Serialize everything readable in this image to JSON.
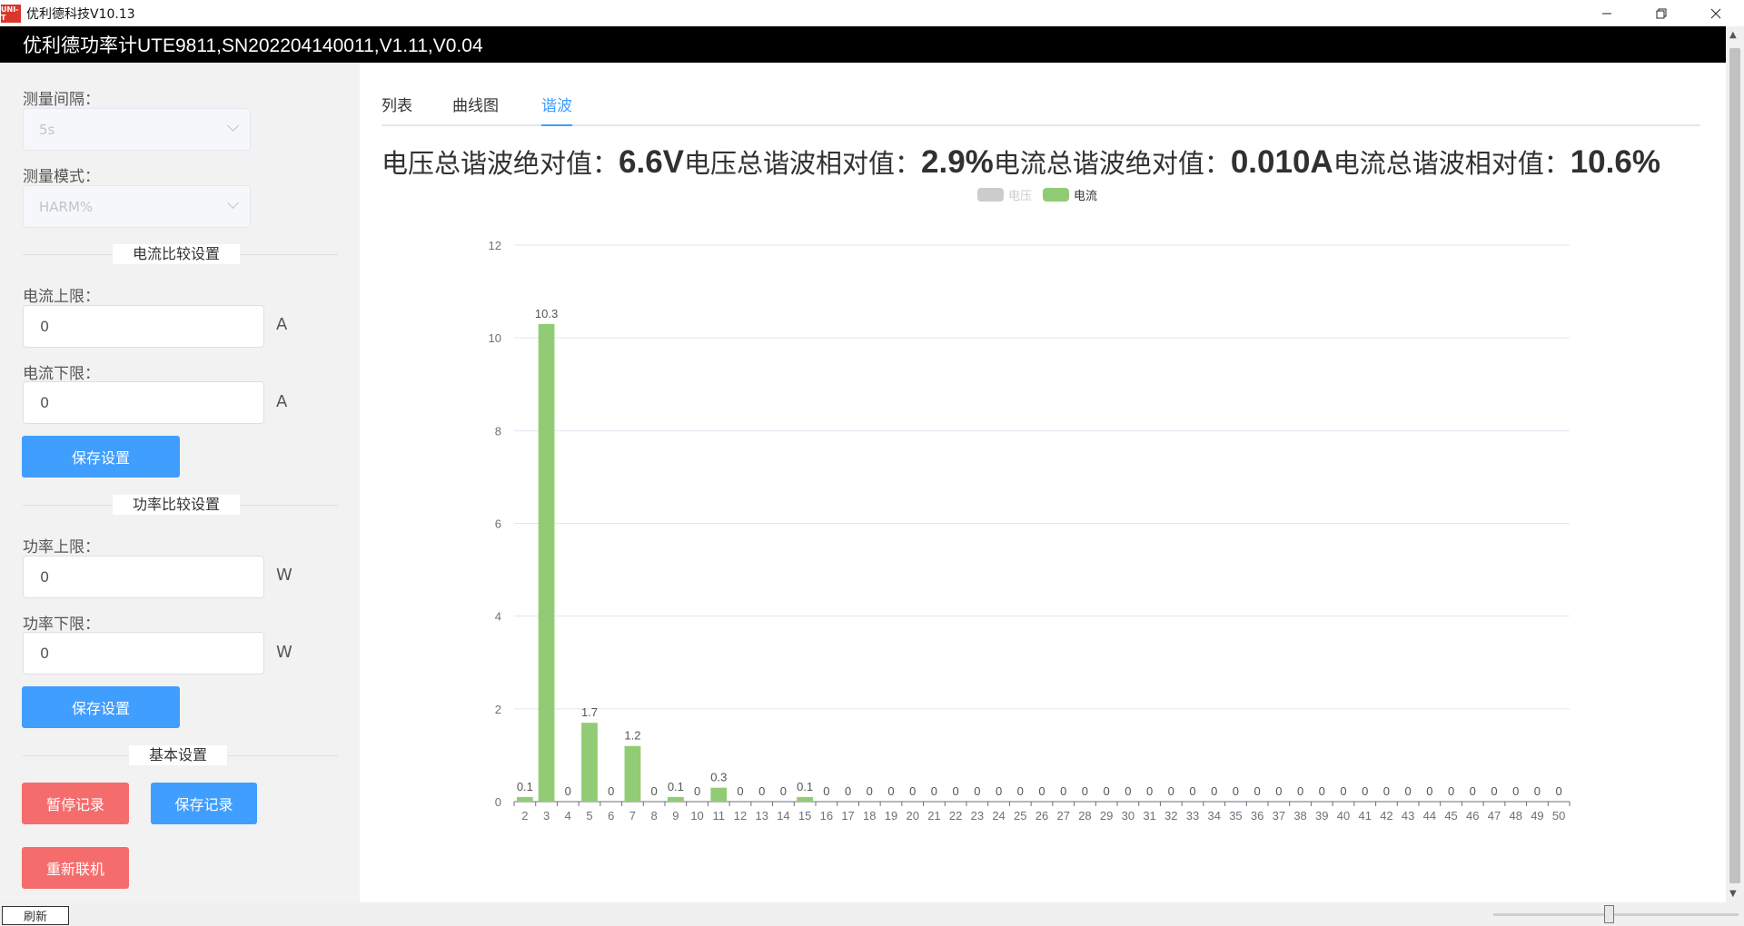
{
  "window": {
    "icon_text": "UNI-T",
    "title": "优利德科技V10.13"
  },
  "header": {
    "title": "优利德功率计UTE9811,SN202204140011,V1.11,V0.04"
  },
  "left_panel": {
    "interval_label": "测量间隔：",
    "interval_value": "5s",
    "mode_label": "测量模式：",
    "mode_value": "HARM%",
    "current_section": "电流比较设置",
    "current_upper_label": "电流上限：",
    "current_upper_value": "0",
    "current_lower_label": "电流下限：",
    "current_lower_value": "0",
    "current_unit": "A",
    "save_settings_1": "保存设置",
    "power_section": "功率比较设置",
    "power_upper_label": "功率上限：",
    "power_upper_value": "0",
    "power_lower_label": "功率下限：",
    "power_lower_value": "0",
    "power_unit": "W",
    "save_settings_2": "保存设置",
    "basic_section": "基本设置",
    "pause_record": "暂停记录",
    "save_record": "保存记录",
    "reconnect": "重新联机"
  },
  "tabs": [
    "列表",
    "曲线图",
    "谐波"
  ],
  "active_tab": "谐波",
  "summary": {
    "v_abs_label": "电压总谐波绝对值：",
    "v_abs_value": "6.6V",
    "v_rel_label": "电压总谐波相对值：",
    "v_rel_value": "2.9%",
    "i_abs_label": "电流总谐波绝对值：",
    "i_abs_value": "0.010A",
    "i_rel_label": "电流总谐波相对值：",
    "i_rel_value": "10.6%"
  },
  "legend": {
    "voltage": "电压",
    "current": "电流",
    "voltage_color": "#cccccc",
    "current_color": "#91cc75"
  },
  "chart_data": {
    "type": "bar",
    "categories": [
      "2",
      "3",
      "4",
      "5",
      "6",
      "7",
      "8",
      "9",
      "10",
      "11",
      "12",
      "13",
      "14",
      "15",
      "16",
      "17",
      "18",
      "19",
      "20",
      "21",
      "22",
      "23",
      "24",
      "25",
      "26",
      "27",
      "28",
      "29",
      "30",
      "31",
      "32",
      "33",
      "34",
      "35",
      "36",
      "37",
      "38",
      "39",
      "40",
      "41",
      "42",
      "43",
      "44",
      "45",
      "46",
      "47",
      "48",
      "49",
      "50"
    ],
    "series": [
      {
        "name": "电流",
        "values": [
          0.1,
          10.3,
          0,
          1.7,
          0,
          1.2,
          0,
          0.1,
          0,
          0.3,
          0,
          0,
          0,
          0.1,
          0,
          0,
          0,
          0,
          0,
          0,
          0,
          0,
          0,
          0,
          0,
          0,
          0,
          0,
          0,
          0,
          0,
          0,
          0,
          0,
          0,
          0,
          0,
          0,
          0,
          0,
          0,
          0,
          0,
          0,
          0,
          0,
          0,
          0,
          0
        ]
      }
    ],
    "ylim": [
      0,
      12
    ],
    "yticks": [
      0,
      2,
      4,
      6,
      8,
      10,
      12
    ],
    "grid": true,
    "legend_position": "top-center",
    "legend_hidden_series": [
      "电压"
    ]
  },
  "statusbar": {
    "refresh": "刷新"
  }
}
